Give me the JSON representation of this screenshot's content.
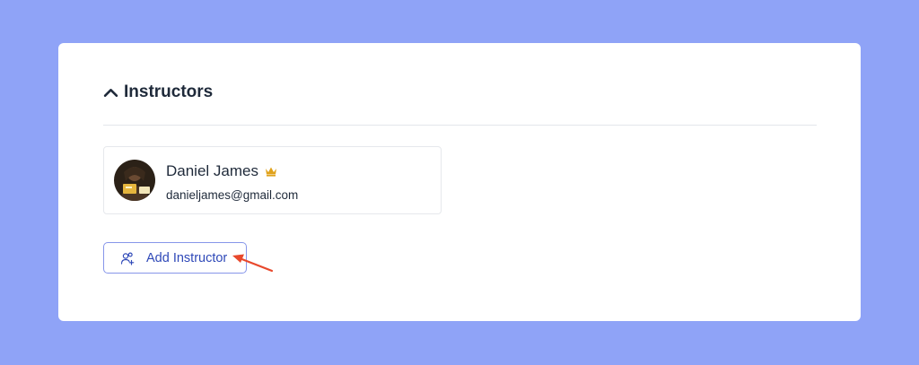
{
  "section": {
    "title": "Instructors",
    "icon": "chevron-up-icon"
  },
  "instructor": {
    "name": "Daniel James",
    "email": "danieljames@gmail.com",
    "badge_icon": "crown-icon",
    "badge_color": "#e0a21b"
  },
  "add_button": {
    "label": "Add Instructor",
    "icon": "add-user-icon",
    "border_color": "#8696ea",
    "text_color": "#2f49b8"
  },
  "annotation": {
    "icon": "red-arrow-icon",
    "color": "#e8482c"
  },
  "colors": {
    "background": "#8fa3f7",
    "card": "#ffffff",
    "text": "#1f2a3a"
  }
}
